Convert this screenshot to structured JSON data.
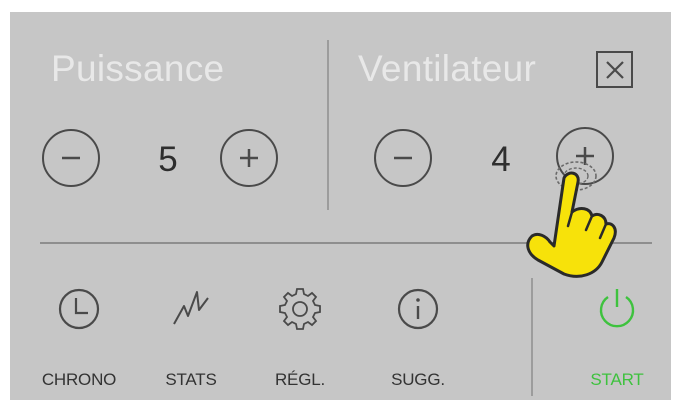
{
  "power": {
    "title": "Puissance",
    "value": "5"
  },
  "fan": {
    "title": "Ventilateur",
    "value": "4"
  },
  "nav": {
    "chrono": "CHRONO",
    "stats": "STATS",
    "settings": "RÉGL.",
    "suggestions": "SUGG.",
    "start": "START"
  },
  "colors": {
    "panel": "#c6c6c6",
    "title": "#e8e8e8",
    "start": "#3ec23e",
    "hand": "#f7e20a"
  },
  "icons": {
    "power_decrease": "minus-icon",
    "power_increase": "plus-icon",
    "fan_decrease": "minus-icon",
    "fan_increase": "plus-icon",
    "close": "close-icon",
    "chrono": "clock-icon",
    "stats": "stats-icon",
    "settings": "gear-icon",
    "suggestions": "info-icon",
    "start": "power-icon",
    "pointer": "pointing-hand-icon"
  }
}
